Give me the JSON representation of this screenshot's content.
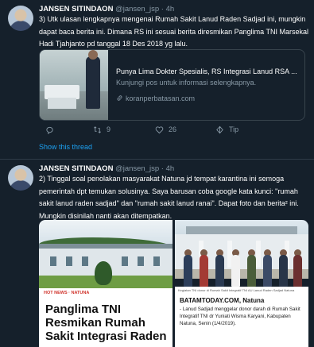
{
  "tweets": [
    {
      "name": "JANSEN SITINDAON",
      "handle": "@jansen_jsp",
      "time": "4h",
      "text": "3) Utk ulasan lengkapnya mengenai Rumah Sakit Lanud Raden Sadjad ini, mungkin dapat baca berita ini. Dimana RS ini sesuai berita diresmikan Panglima TNI Marsekal Hadi Tjahjanto pd tanggal 18 Des 2018 yg lalu.",
      "card": {
        "title": "Punya Lima Dokter Spesialis, RS Integrasi Lanud RSA ...",
        "description": "Kunjungi pos untuk informasi selengkapnya.",
        "domain": "koranperbatasan.com"
      },
      "actions": {
        "reply": "",
        "retweets": "9",
        "likes": "26",
        "tip": "Tip"
      },
      "show_thread": "Show this thread"
    },
    {
      "name": "JANSEN SITINDAON",
      "handle": "@jansen_jsp",
      "time": "4h",
      "text": "2) Tinggal soal penolakan masyarakat Natuna jd tempat karantina ini semoga pemerintah dpt temukan solusinya. Saya barusan coba google kata kunci: \"rumah sakit lanud raden sadjad\" dan \"rumah sakit lanud ranai\". Dapat foto dan berita² ini. Mungkin disinilah nanti akan ditempatkan.",
      "media": {
        "left": {
          "source_tag": "HOT NEWS · NATUNA",
          "headline": "Panglima TNI Resmikan Rumah Sakit Integrasi Raden"
        },
        "right": {
          "caption_top": "Kegiatan TNI donor di Rumah Sakit Integratif TNI AU Lanud Raden Sadjad Natuna",
          "brand": "BATAMTODAY.COM, Natuna",
          "body": "- Lanud Sadjad menggelar donor darah di Rumah Sakit Integratif TNI dr Yuniati Wisma Karyani, Kabupaten Natuna, Senin (1/4/2019)."
        }
      }
    }
  ],
  "colors": {
    "background": "#15202b",
    "accent": "#1da1f2",
    "muted": "#8899a6",
    "text": "#ffffff",
    "border": "#38444d"
  },
  "icons": [
    "avatar",
    "link-icon",
    "reply-icon",
    "retweet-icon",
    "like-icon",
    "tip-icon"
  ]
}
